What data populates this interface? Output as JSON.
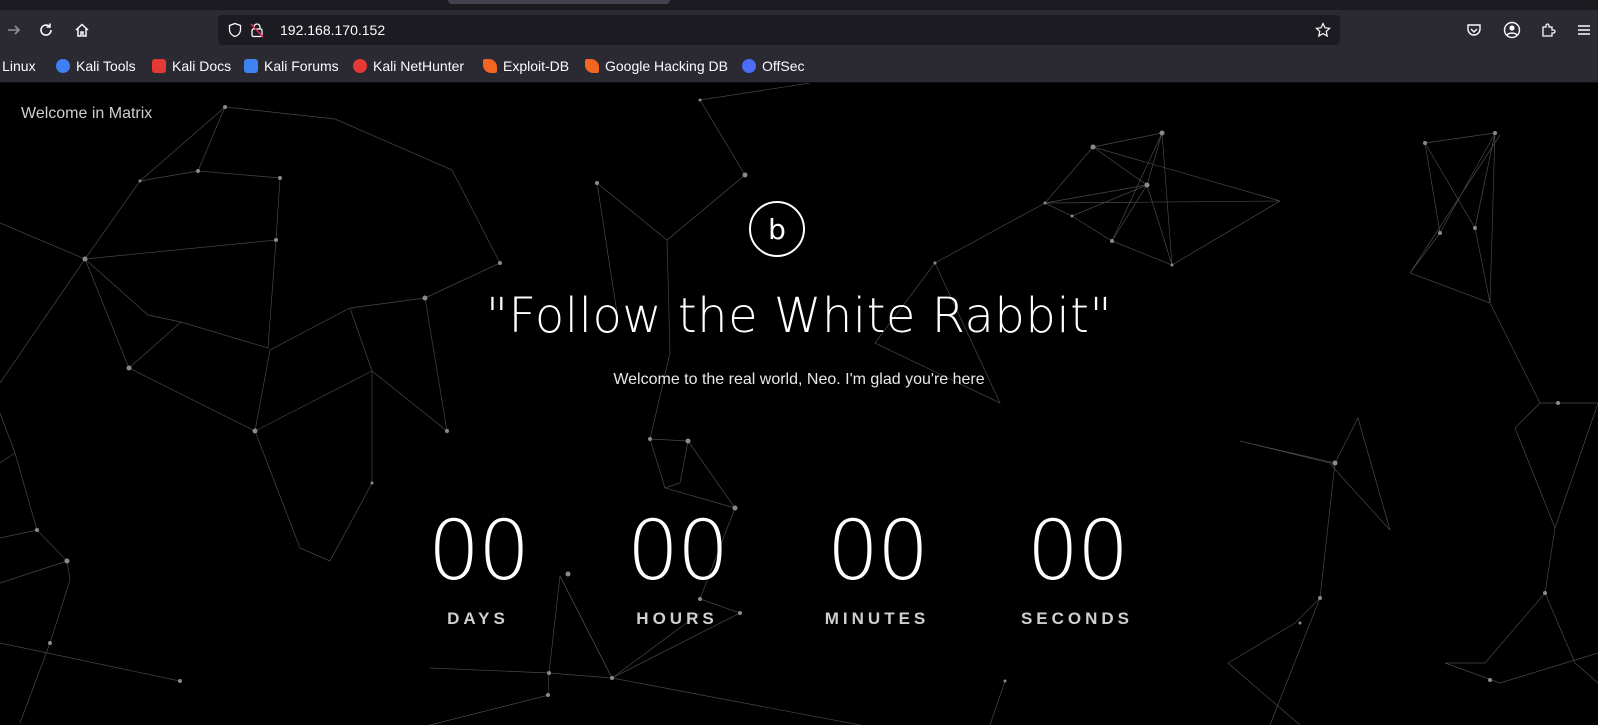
{
  "browser": {
    "url": "192.168.170.152",
    "bookmarks": [
      {
        "label": "li Linux",
        "icon": "kali-linux-icon",
        "color": "#367bf0"
      },
      {
        "label": "Kali Tools",
        "icon": "kali-tools-icon",
        "color": "#3f7ff5"
      },
      {
        "label": "Kali Docs",
        "icon": "kali-docs-icon",
        "color": "#e53935"
      },
      {
        "label": "Kali Forums",
        "icon": "kali-forums-icon",
        "color": "#3c82f0"
      },
      {
        "label": "Kali NetHunter",
        "icon": "kali-nethunter-icon",
        "color": "#e53935"
      },
      {
        "label": "Exploit-DB",
        "icon": "exploit-db-icon",
        "color": "#f26522"
      },
      {
        "label": "Google Hacking DB",
        "icon": "google-hacking-db-icon",
        "color": "#f26522"
      },
      {
        "label": "OffSec",
        "icon": "offsec-icon",
        "color": "#4a6cf7"
      }
    ]
  },
  "page": {
    "welcome": "Welcome in Matrix",
    "logo_letter": "b",
    "headline": "\"Follow the White Rabbit\"",
    "subline": "Welcome to the real world, Neo. I'm glad you're here",
    "countdown": [
      {
        "value": "00",
        "label": "DAYS"
      },
      {
        "value": "00",
        "label": "HOURS"
      },
      {
        "value": "00",
        "label": "MINUTES"
      },
      {
        "value": "00",
        "label": "SECONDS"
      }
    ]
  }
}
